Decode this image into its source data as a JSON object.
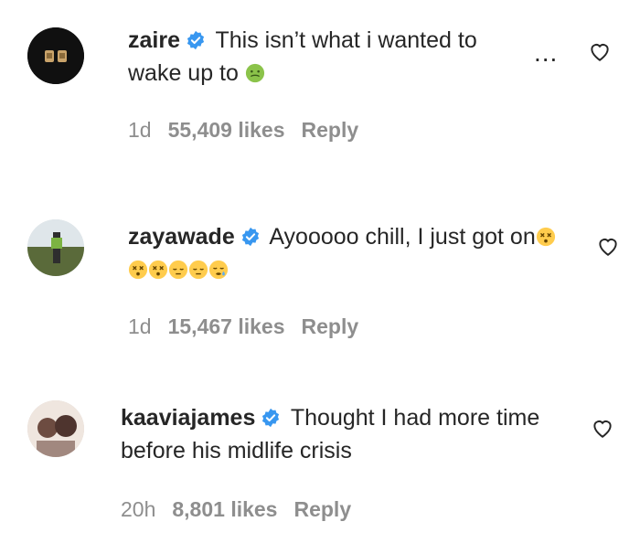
{
  "comments": [
    {
      "username": "zaire",
      "text": "This isn’t what i wanted to wake up to",
      "emoji_names": [
        "nauseated-face"
      ],
      "time": "1d",
      "likes": "55,409 likes",
      "reply": "Reply",
      "verified": true,
      "show_more": true,
      "more_label": "..."
    },
    {
      "username": "zayawade",
      "text": "Ayooooo chill, I just got on",
      "emoji_names": [
        "dizzy-face",
        "dizzy-face",
        "dizzy-face",
        "pensive-face",
        "pensive-face",
        "sleepy-face"
      ],
      "time": "1d",
      "likes": "15,467 likes",
      "reply": "Reply",
      "verified": true
    },
    {
      "username": "kaaviajames",
      "text": "Thought I had more time before his midlife crisis",
      "time": "20h",
      "likes": "8,801 likes",
      "reply": "Reply",
      "verified": true
    }
  ],
  "colors": {
    "verified_blue": "#3897f0",
    "meta_gray": "#8e8e8e",
    "text": "#262626",
    "emoji_green": "#8bc34a",
    "emoji_yellow": "#ffcc4d"
  }
}
